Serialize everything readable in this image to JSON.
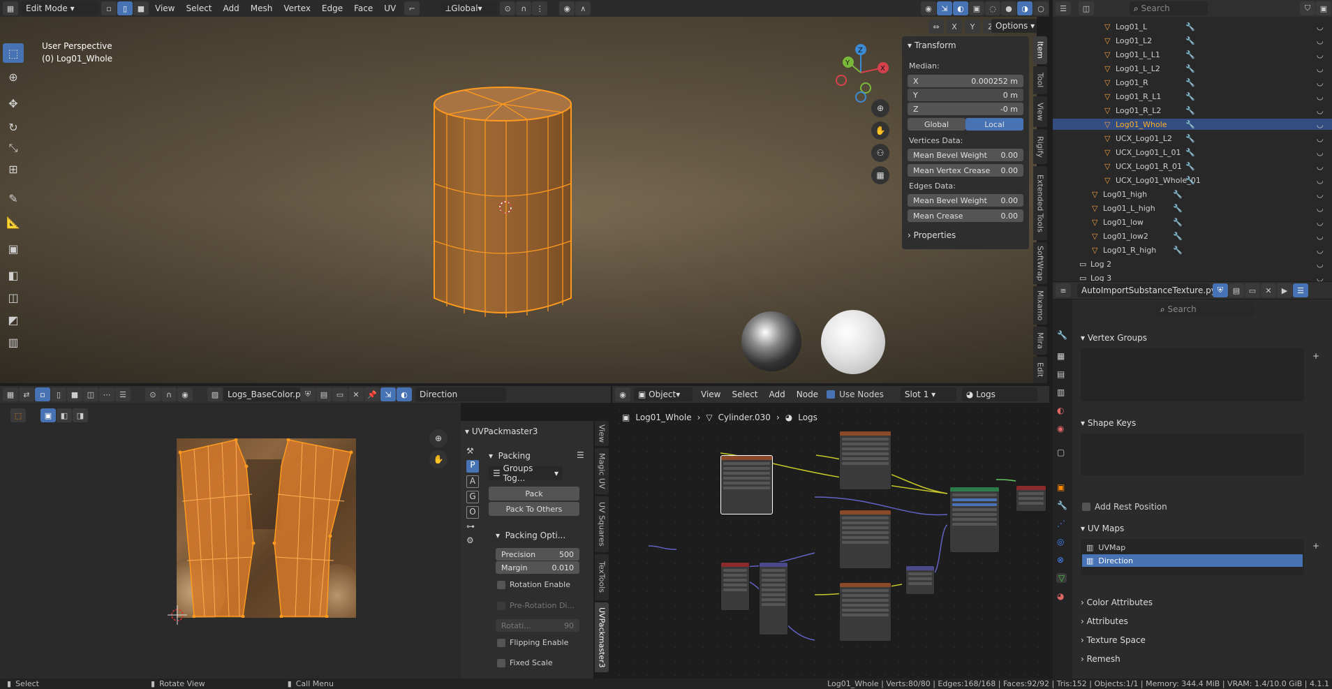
{
  "top_header": {
    "mode": "Edit Mode",
    "menus": [
      "View",
      "Select",
      "Add",
      "Mesh",
      "Vertex",
      "Edge",
      "Face",
      "UV"
    ],
    "orientation": "Global",
    "options": "Options",
    "axes": [
      "X",
      "Y",
      "Z"
    ]
  },
  "viewport": {
    "perspective": "User Perspective",
    "object": "(0) Log01_Whole"
  },
  "transform": {
    "title": "Transform",
    "median": "Median:",
    "x_label": "X",
    "x_val": "0.000252 m",
    "y_label": "Y",
    "y_val": "0 m",
    "z_label": "Z",
    "z_val": "-0 m",
    "global": "Global",
    "local": "Local",
    "vertices_data": "Vertices Data:",
    "mean_bevel_weight": "Mean Bevel Weight",
    "mbw_val": "0.00",
    "mean_vertex_crease": "Mean Vertex Crease",
    "mvc_val": "0.00",
    "edges_data": "Edges Data:",
    "emb": "Mean Bevel Weight",
    "emb_val": "0.00",
    "mean_crease": "Mean Crease",
    "mc_val": "0.00",
    "properties": "Properties"
  },
  "side_tabs": [
    "Item",
    "Tool",
    "View",
    "Rigify",
    "Extended Tools",
    "SoftWrap",
    "Mixamo",
    "Mira",
    "Edit"
  ],
  "outliner": {
    "search": "Search",
    "items": [
      "Log01_L",
      "Log01_L2",
      "Log01_L_L1",
      "Log01_L_L2",
      "Log01_R",
      "Log01_R_L1",
      "Log01_R_L2",
      "Log01_Whole",
      "UCX_Log01_L2",
      "UCX_Log01_L_01",
      "UCX_Log01_R_01",
      "UCX_Log01_Whole_01",
      "Log01_high",
      "Log01_L_high",
      "Log01_low",
      "Log01_low2",
      "Log01_R_high",
      "Log 2",
      "Log 3"
    ]
  },
  "text_editor": {
    "filename": "AutoImportSubstanceTexture.py"
  },
  "properties": {
    "search": "Search",
    "vertex_groups": "Vertex Groups",
    "shape_keys": "Shape Keys",
    "add_rest_position": "Add Rest Position",
    "uv_maps": "UV Maps",
    "uvmap1": "UVMap",
    "uvmap2": "Direction",
    "color_attributes": "Color Attributes",
    "attributes": "Attributes",
    "texture_space": "Texture Space",
    "remesh": "Remesh"
  },
  "uv_editor": {
    "image": "Logs_BaseColor.png",
    "uvmap": "Direction",
    "tabs": [
      "View",
      "Magic UV",
      "UV Squares",
      "TexTools",
      "UVPackmaster3"
    ]
  },
  "uvpack": {
    "title": "UVPackmaster3",
    "packing": "Packing",
    "groups": "Groups Tog...",
    "pack": "Pack",
    "pack_others": "Pack To Others",
    "packing_options": "Packing Opti...",
    "precision": "Precision",
    "precision_val": "500",
    "margin": "Margin",
    "margin_val": "0.010",
    "rotation_enable": "Rotation Enable",
    "pre_rotation": "Pre-Rotation Di...",
    "rotation_step": "Rotati...",
    "rotation_step_val": "90",
    "flipping": "Flipping Enable",
    "fixed_scale": "Fixed Scale",
    "letters": [
      "P",
      "A",
      "G",
      "O"
    ]
  },
  "node_editor": {
    "type": "Object",
    "menus": [
      "View",
      "Select",
      "Add",
      "Node"
    ],
    "use_nodes": "Use Nodes",
    "slot": "Slot 1",
    "material": "Logs",
    "bc1": "Log01_Whole",
    "bc2": "Cylinder.030",
    "bc3": "Logs"
  },
  "status": {
    "select": "Select",
    "rotate": "Rotate View",
    "call_menu": "Call Menu",
    "stats": "Log01_Whole | Verts:80/80 | Edges:168/168 | Faces:92/92 | Tris:152 | Objects:1/1 | Memory: 344.4 MiB | VRAM: 1.4/10.0 GiB | 4.1.1"
  },
  "colors": {
    "accent": "#4772b3",
    "select": "#ff9a1f",
    "bg": "#303030"
  }
}
